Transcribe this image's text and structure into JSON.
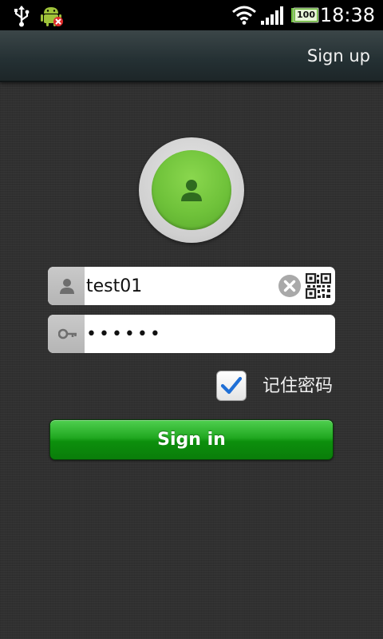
{
  "status_bar": {
    "time": "18:38",
    "battery_level": "100",
    "icons": [
      "usb-icon",
      "android-debug-icon",
      "wifi-icon",
      "signal-icon",
      "battery-icon"
    ]
  },
  "action_bar": {
    "signup_label": "Sign up"
  },
  "login_form": {
    "username_value": "test01",
    "password_value": "••••••",
    "remember_label": "记住密码",
    "remember_checked": true,
    "signin_label": "Sign in"
  },
  "colors": {
    "accent_green": "#21a821",
    "avatar_green": "#6fc23a",
    "checkmark_blue": "#1f6fd6",
    "background": "#303030"
  }
}
